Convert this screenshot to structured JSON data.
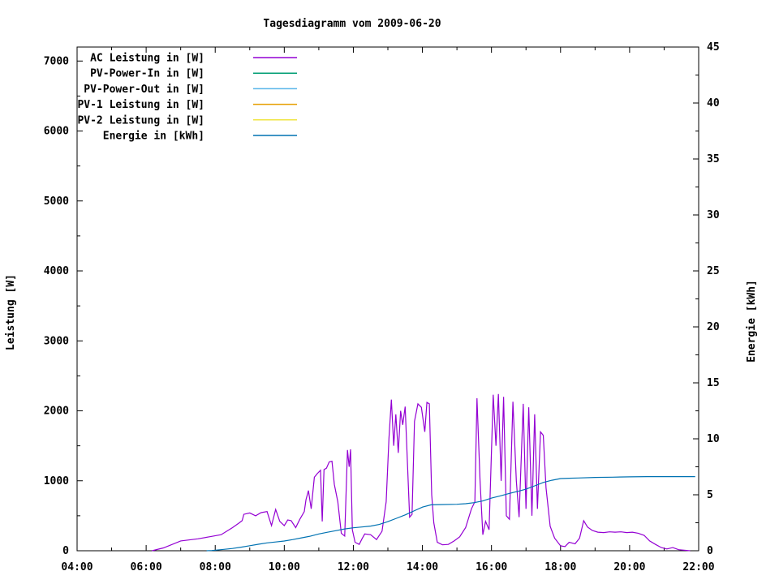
{
  "chart_data": {
    "type": "line",
    "title": "Tagesdiagramm vom 2009-06-20",
    "grid": false,
    "legend_position": "top-left",
    "background_color": "#ffffff",
    "axis_color": "#000000",
    "x_axis": {
      "range_hours": [
        4,
        22
      ],
      "minor_step_hours": 1,
      "ticks": [
        {
          "v": 4,
          "label": "04:00"
        },
        {
          "v": 6,
          "label": "06:00"
        },
        {
          "v": 8,
          "label": "08:00"
        },
        {
          "v": 10,
          "label": "10:00"
        },
        {
          "v": 12,
          "label": "12:00"
        },
        {
          "v": 14,
          "label": "14:00"
        },
        {
          "v": 16,
          "label": "16:00"
        },
        {
          "v": 18,
          "label": "18:00"
        },
        {
          "v": 20,
          "label": "20:00"
        },
        {
          "v": 22,
          "label": "22:00"
        }
      ]
    },
    "y_left": {
      "label": "Leistung [W]",
      "range": [
        0,
        7200
      ],
      "minor_step": 500,
      "ticks": [
        {
          "v": 0,
          "label": "0"
        },
        {
          "v": 1000,
          "label": "1000"
        },
        {
          "v": 2000,
          "label": "2000"
        },
        {
          "v": 3000,
          "label": "3000"
        },
        {
          "v": 4000,
          "label": "4000"
        },
        {
          "v": 5000,
          "label": "5000"
        },
        {
          "v": 6000,
          "label": "6000"
        },
        {
          "v": 7000,
          "label": "7000"
        }
      ]
    },
    "y_right": {
      "label": "Energie [kWh]",
      "range": [
        0,
        45
      ],
      "minor_step": 2.5,
      "ticks": [
        {
          "v": 0,
          "label": "0"
        },
        {
          "v": 5,
          "label": "5"
        },
        {
          "v": 10,
          "label": "10"
        },
        {
          "v": 15,
          "label": "15"
        },
        {
          "v": 20,
          "label": "20"
        },
        {
          "v": 25,
          "label": "25"
        },
        {
          "v": 30,
          "label": "30"
        },
        {
          "v": 35,
          "label": "35"
        },
        {
          "v": 40,
          "label": "40"
        },
        {
          "v": 45,
          "label": "45"
        }
      ]
    },
    "series": [
      {
        "name": "AC Leistung in [W]",
        "color": "#9400d3",
        "axis": "left",
        "points": [
          [
            6.17,
            0
          ],
          [
            6.5,
            40
          ],
          [
            7.0,
            140
          ],
          [
            7.5,
            170
          ],
          [
            7.83,
            200
          ],
          [
            8.17,
            230
          ],
          [
            8.5,
            330
          ],
          [
            8.7,
            400
          ],
          [
            8.78,
            430
          ],
          [
            8.83,
            520
          ],
          [
            9.0,
            540
          ],
          [
            9.17,
            500
          ],
          [
            9.33,
            545
          ],
          [
            9.5,
            560
          ],
          [
            9.63,
            360
          ],
          [
            9.75,
            590
          ],
          [
            9.87,
            420
          ],
          [
            10.0,
            360
          ],
          [
            10.1,
            440
          ],
          [
            10.2,
            430
          ],
          [
            10.33,
            330
          ],
          [
            10.45,
            450
          ],
          [
            10.58,
            560
          ],
          [
            10.63,
            730
          ],
          [
            10.7,
            860
          ],
          [
            10.78,
            600
          ],
          [
            10.87,
            1050
          ],
          [
            10.95,
            1100
          ],
          [
            11.05,
            1150
          ],
          [
            11.1,
            420
          ],
          [
            11.15,
            1160
          ],
          [
            11.22,
            1180
          ],
          [
            11.3,
            1270
          ],
          [
            11.38,
            1280
          ],
          [
            11.45,
            950
          ],
          [
            11.55,
            700
          ],
          [
            11.65,
            250
          ],
          [
            11.75,
            210
          ],
          [
            11.83,
            1440
          ],
          [
            11.88,
            1200
          ],
          [
            11.92,
            1450
          ],
          [
            11.97,
            300
          ],
          [
            12.05,
            120
          ],
          [
            12.17,
            90
          ],
          [
            12.25,
            170
          ],
          [
            12.33,
            240
          ],
          [
            12.5,
            230
          ],
          [
            12.67,
            160
          ],
          [
            12.83,
            280
          ],
          [
            12.95,
            700
          ],
          [
            13.03,
            1600
          ],
          [
            13.1,
            2160
          ],
          [
            13.17,
            1500
          ],
          [
            13.23,
            1950
          ],
          [
            13.3,
            1400
          ],
          [
            13.37,
            2000
          ],
          [
            13.43,
            1800
          ],
          [
            13.5,
            2060
          ],
          [
            13.57,
            1200
          ],
          [
            13.63,
            480
          ],
          [
            13.7,
            520
          ],
          [
            13.77,
            1850
          ],
          [
            13.87,
            2100
          ],
          [
            13.97,
            2050
          ],
          [
            14.07,
            1700
          ],
          [
            14.13,
            2120
          ],
          [
            14.2,
            2100
          ],
          [
            14.27,
            800
          ],
          [
            14.33,
            400
          ],
          [
            14.43,
            120
          ],
          [
            14.58,
            85
          ],
          [
            14.75,
            90
          ],
          [
            14.92,
            140
          ],
          [
            15.08,
            200
          ],
          [
            15.25,
            330
          ],
          [
            15.42,
            600
          ],
          [
            15.52,
            700
          ],
          [
            15.58,
            2180
          ],
          [
            15.67,
            1000
          ],
          [
            15.75,
            230
          ],
          [
            15.83,
            420
          ],
          [
            15.93,
            300
          ],
          [
            16.05,
            2230
          ],
          [
            16.13,
            1500
          ],
          [
            16.2,
            2240
          ],
          [
            16.28,
            1000
          ],
          [
            16.35,
            2200
          ],
          [
            16.43,
            500
          ],
          [
            16.52,
            450
          ],
          [
            16.62,
            2130
          ],
          [
            16.72,
            1000
          ],
          [
            16.8,
            480
          ],
          [
            16.92,
            2100
          ],
          [
            17.0,
            600
          ],
          [
            17.08,
            2050
          ],
          [
            17.17,
            500
          ],
          [
            17.25,
            1950
          ],
          [
            17.33,
            600
          ],
          [
            17.42,
            1700
          ],
          [
            17.5,
            1650
          ],
          [
            17.58,
            900
          ],
          [
            17.7,
            350
          ],
          [
            17.83,
            180
          ],
          [
            18.0,
            70
          ],
          [
            18.13,
            60
          ],
          [
            18.25,
            120
          ],
          [
            18.42,
            100
          ],
          [
            18.55,
            180
          ],
          [
            18.67,
            430
          ],
          [
            18.78,
            340
          ],
          [
            18.92,
            290
          ],
          [
            19.08,
            265
          ],
          [
            19.25,
            260
          ],
          [
            19.42,
            270
          ],
          [
            19.58,
            265
          ],
          [
            19.75,
            270
          ],
          [
            19.92,
            260
          ],
          [
            20.08,
            265
          ],
          [
            20.25,
            250
          ],
          [
            20.42,
            220
          ],
          [
            20.58,
            140
          ],
          [
            20.75,
            90
          ],
          [
            20.92,
            45
          ],
          [
            21.08,
            25
          ],
          [
            21.25,
            45
          ],
          [
            21.42,
            15
          ],
          [
            21.58,
            8
          ],
          [
            21.75,
            0
          ]
        ]
      },
      {
        "name": "PV-Power-In in [W]",
        "color": "#009e73",
        "axis": "left",
        "points": []
      },
      {
        "name": "PV-Power-Out in [W]",
        "color": "#56b4e9",
        "axis": "left",
        "points": []
      },
      {
        "name": "PV-1 Leistung in [W]",
        "color": "#e69f00",
        "axis": "left",
        "points": []
      },
      {
        "name": "PV-2 Leistung in [W]",
        "color": "#f0e442",
        "axis": "left",
        "points": []
      },
      {
        "name": "Energie in [kWh]",
        "color": "#0072b2",
        "axis": "right",
        "points": [
          [
            7.75,
            0
          ],
          [
            7.9,
            0.02
          ],
          [
            8.0,
            0.05
          ],
          [
            8.25,
            0.12
          ],
          [
            8.5,
            0.2
          ],
          [
            8.75,
            0.32
          ],
          [
            9.0,
            0.45
          ],
          [
            9.25,
            0.58
          ],
          [
            9.5,
            0.7
          ],
          [
            9.75,
            0.78
          ],
          [
            10.0,
            0.87
          ],
          [
            10.25,
            1.0
          ],
          [
            10.5,
            1.15
          ],
          [
            10.75,
            1.3
          ],
          [
            11.0,
            1.5
          ],
          [
            11.25,
            1.65
          ],
          [
            11.5,
            1.8
          ],
          [
            11.75,
            1.95
          ],
          [
            12.0,
            2.05
          ],
          [
            12.25,
            2.12
          ],
          [
            12.5,
            2.2
          ],
          [
            12.75,
            2.35
          ],
          [
            13.0,
            2.6
          ],
          [
            13.25,
            2.9
          ],
          [
            13.5,
            3.2
          ],
          [
            13.75,
            3.55
          ],
          [
            14.0,
            3.9
          ],
          [
            14.25,
            4.1
          ],
          [
            14.5,
            4.12
          ],
          [
            15.0,
            4.15
          ],
          [
            15.25,
            4.2
          ],
          [
            15.5,
            4.3
          ],
          [
            15.75,
            4.45
          ],
          [
            16.0,
            4.7
          ],
          [
            16.25,
            4.9
          ],
          [
            16.5,
            5.1
          ],
          [
            16.75,
            5.3
          ],
          [
            17.0,
            5.5
          ],
          [
            17.25,
            5.8
          ],
          [
            17.5,
            6.1
          ],
          [
            17.75,
            6.3
          ],
          [
            18.0,
            6.45
          ],
          [
            18.25,
            6.48
          ],
          [
            18.5,
            6.5
          ],
          [
            19.0,
            6.55
          ],
          [
            19.5,
            6.57
          ],
          [
            20.0,
            6.6
          ],
          [
            20.5,
            6.62
          ],
          [
            21.0,
            6.62
          ],
          [
            21.9,
            6.62
          ]
        ]
      }
    ]
  }
}
